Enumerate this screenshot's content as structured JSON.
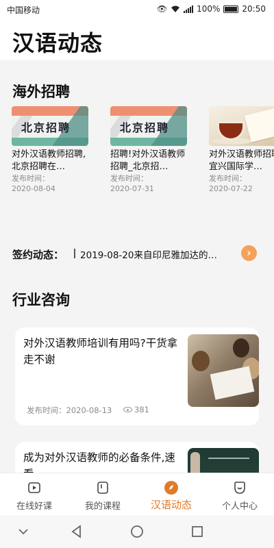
{
  "status_bar": {
    "carrier": "中国移动",
    "battery": "100%",
    "time": "20:50"
  },
  "header": {
    "title": "汉语动态"
  },
  "overseas_jobs": {
    "title": "海外招聘",
    "image_label": "北京招聘",
    "items": [
      {
        "title": "对外汉语教师招聘,北京招聘在…",
        "meta_label": "发布时间：",
        "date": "2020-08-04"
      },
      {
        "title": "招聘!对外汉语教师招聘_北京招…",
        "meta_label": "发布时间：",
        "date": "2020-07-31"
      },
      {
        "title": "对外汉语教师招聘!宜兴国际学…",
        "meta_label": "发布时间：",
        "date": "2020-07-22"
      }
    ]
  },
  "signing": {
    "label": "签约动态：",
    "text": "2019-08-20来自印尼雅加达的…",
    "more_glyph": "›"
  },
  "industry": {
    "title": "行业咨询",
    "articles": [
      {
        "title": "对外汉语教师培训有用吗?干货拿走不谢",
        "meta": "发布时间：2020-08-13",
        "views": "381"
      },
      {
        "title": "成为对外汉语教师的必备条件,速看",
        "meta": "",
        "views": ""
      }
    ]
  },
  "tabs": [
    {
      "label": "在线好课",
      "icon": "play-icon"
    },
    {
      "label": "我的课程",
      "icon": "course-icon"
    },
    {
      "label": "汉语动态",
      "icon": "news-icon",
      "active": true
    },
    {
      "label": "个人中心",
      "icon": "profile-icon"
    }
  ],
  "colors": {
    "accent": "#e07b2a",
    "more_button": "#f4a25a"
  }
}
